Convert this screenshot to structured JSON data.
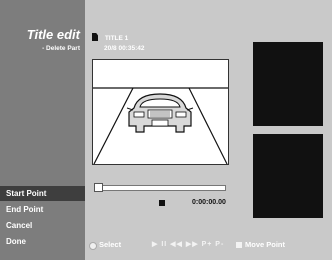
{
  "screen": {
    "heading": "Title edit",
    "subheading": "- Delete Part"
  },
  "title_info": {
    "title_name": "TITLE 1",
    "datetime": "20/8  00:35:42"
  },
  "menu": {
    "items": [
      {
        "label": "Start Point",
        "active": true
      },
      {
        "label": "End Point",
        "active": false
      },
      {
        "label": "Cancel",
        "active": false
      },
      {
        "label": "Done",
        "active": false
      }
    ]
  },
  "timeline": {
    "timecode": "0:00:00.00"
  },
  "footer": {
    "select_label": "Select",
    "transport_label": "▶ II ◀◀ ▶▶ P+ P-",
    "move_point_label": "Move Point"
  },
  "icons": {
    "title": "document-icon",
    "select": "select-circle-icon",
    "move_point": "move-point-square-icon",
    "transport": "transport-controls-icon"
  },
  "colors": {
    "sidebar": "#7d7d7d",
    "main": "#c9c9c9",
    "active_menu": "#3e3e3e",
    "thumbnail": "#111111",
    "text": "#ffffff"
  }
}
